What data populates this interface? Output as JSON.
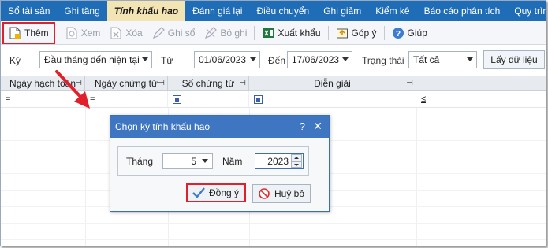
{
  "tabs": [
    "Sổ tài sản",
    "Ghi tăng",
    "Tính khấu hao",
    "Đánh giá lại",
    "Điều chuyển",
    "Ghi giảm",
    "Kiểm kê",
    "Báo cáo phân tích",
    "Quy trình"
  ],
  "active_tab": "Tính khấu hao",
  "toolbar": {
    "add": "Thêm",
    "view": "Xem",
    "delete": "Xóa",
    "post": "Ghi sổ",
    "unpost": "Bỏ ghi",
    "export": "Xuất khẩu",
    "feedback": "Góp ý",
    "help": "Giúp"
  },
  "filters": {
    "period_label": "Kỳ",
    "period_value": "Đầu tháng đến hiện tại",
    "from_label": "Từ",
    "from_value": "01/06/2023",
    "to_label": "Đến",
    "to_value": "17/06/2023",
    "status_label": "Trạng thái",
    "status_value": "Tất cả",
    "load_button": "Lấy dữ liệu"
  },
  "grid": {
    "columns": [
      "Ngày hạch toán",
      "Ngày chứng từ",
      "Số chứng từ",
      "Diễn giải"
    ],
    "filter_symbols": [
      "=",
      "=",
      "",
      "",
      "≤"
    ]
  },
  "dialog": {
    "title": "Chọn kỳ tính khấu hao",
    "help": "?",
    "close": "✕",
    "month_label": "Tháng",
    "month_value": "5",
    "year_label": "Năm",
    "year_value": "2023",
    "ok_button": "Đồng ý",
    "cancel_button": "Huỷ bỏ"
  },
  "colors": {
    "tab_bar": "#1f6db6",
    "active_tab": "#f3e4b4",
    "dialog_title": "#3f76c2",
    "highlight": "#e0202a"
  }
}
